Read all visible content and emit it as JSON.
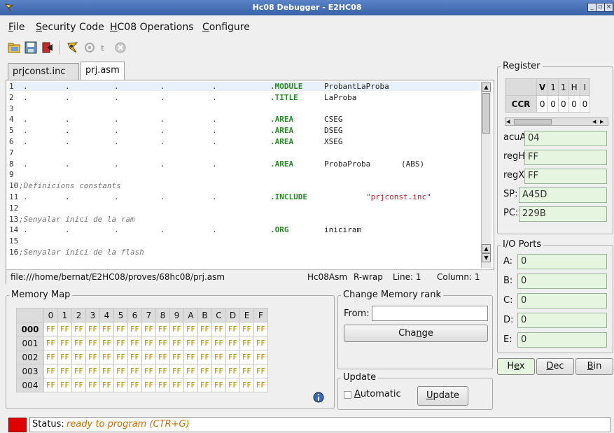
{
  "window": {
    "title": "Hc08 Debugger - E2HC08"
  },
  "menu": [
    {
      "label": "File",
      "mnemonic": "F"
    },
    {
      "label": "Security Code",
      "mnemonic": "S"
    },
    {
      "label": "HC08 Operations",
      "mnemonic": "H"
    },
    {
      "label": "Configure",
      "mnemonic": "C"
    }
  ],
  "toolbar": [
    "open-folder-icon",
    "save-icon",
    "exit-icon",
    "program-chip-icon",
    "run-icon",
    "step-icon",
    "stop-icon"
  ],
  "editor": {
    "tabs": [
      "prjconst.inc",
      "prj.asm"
    ],
    "active_tab": 1,
    "lines": [
      {
        "n": "1",
        "dots": true,
        "directive": ".MODULE",
        "arg": "ProbantLaProba"
      },
      {
        "n": "2",
        "dots": true,
        "directive": ".TITLE",
        "arg": "LaProba"
      },
      {
        "n": "3"
      },
      {
        "n": "4",
        "dots": true,
        "directive": ".AREA",
        "arg": "CSEG"
      },
      {
        "n": "5",
        "dots": true,
        "directive": ".AREA",
        "arg": "DSEG"
      },
      {
        "n": "6",
        "dots": true,
        "directive": ".AREA",
        "arg": "XSEG"
      },
      {
        "n": "7"
      },
      {
        "n": "8",
        "dots": true,
        "directive": ".AREA",
        "arg": "ProbaProba",
        "arg2": "(ABS)"
      },
      {
        "n": "9"
      },
      {
        "n": "10",
        "comment": ";Definicions constants"
      },
      {
        "n": "11",
        "dots": true,
        "directive": ".INCLUDE",
        "string": "\"prjconst.inc\""
      },
      {
        "n": "12"
      },
      {
        "n": "13",
        "comment": ";Senyalar inici de la ram"
      },
      {
        "n": "14",
        "dots": true,
        "directive": ".ORG",
        "arg": "iniciram"
      },
      {
        "n": "15"
      },
      {
        "n": "16",
        "comment": ";Senyalar inici de la flash"
      }
    ],
    "status": {
      "path": "file:///home/bernat/E2HC08/proves/68hc08/prj.asm",
      "mode": "Hc08Asm",
      "wrap": "R-wrap",
      "line": "Line: 1",
      "column": "Column: 1"
    }
  },
  "memory_map": {
    "title": "Memory Map",
    "columns": [
      "0",
      "1",
      "2",
      "3",
      "4",
      "5",
      "6",
      "7",
      "8",
      "9",
      "A",
      "B",
      "C",
      "D",
      "E",
      "F"
    ],
    "rows": [
      {
        "addr": "000",
        "bold": true,
        "values": [
          "FF",
          "FF",
          "FF",
          "FF",
          "FF",
          "FF",
          "FF",
          "FF",
          "FF",
          "FF",
          "FF",
          "FF",
          "FF",
          "FF",
          "FF",
          "FF"
        ]
      },
      {
        "addr": "001",
        "values": [
          "FF",
          "FF",
          "FF",
          "FF",
          "FF",
          "FF",
          "FF",
          "FF",
          "FF",
          "FF",
          "FF",
          "FF",
          "FF",
          "FF",
          "FF",
          "FF"
        ]
      },
      {
        "addr": "002",
        "values": [
          "FF",
          "FF",
          "FF",
          "FF",
          "FF",
          "FF",
          "FF",
          "FF",
          "FF",
          "FF",
          "FF",
          "FF",
          "FF",
          "FF",
          "FF",
          "FF"
        ]
      },
      {
        "addr": "003",
        "values": [
          "FF",
          "FF",
          "FF",
          "FF",
          "FF",
          "FF",
          "FF",
          "FF",
          "FF",
          "FF",
          "FF",
          "FF",
          "FF",
          "FF",
          "FF",
          "FF"
        ]
      },
      {
        "addr": "004",
        "values": [
          "FF",
          "FF",
          "FF",
          "FF",
          "FF",
          "FF",
          "FF",
          "FF",
          "FF",
          "FF",
          "FF",
          "FF",
          "FF",
          "FF",
          "FF",
          "FF"
        ]
      }
    ]
  },
  "change_rank": {
    "title": "Change Memory rank",
    "from_label": "From:",
    "from_value": "",
    "button": "Change",
    "button_mnemonic": "n"
  },
  "update": {
    "title": "Update",
    "automatic_label": "Automatic",
    "automatic_checked": false,
    "button": "Update",
    "button_mnemonic": "U"
  },
  "register": {
    "title": "Register",
    "ccr_header": [
      "V",
      "1",
      "1",
      "H",
      "I"
    ],
    "ccr_label": "CCR",
    "ccr_values": [
      "0",
      "0",
      "0",
      "0",
      "0"
    ],
    "fields": [
      {
        "label": "acuA:",
        "value": "04"
      },
      {
        "label": "regH:",
        "value": "FF"
      },
      {
        "label": "regX:",
        "value": "FF"
      },
      {
        "label": "SP:",
        "value": "A45D"
      },
      {
        "label": "PC:",
        "value": "229B"
      }
    ]
  },
  "io_ports": {
    "title": "I/O Ports",
    "ports": [
      {
        "label": "A:",
        "value": "0"
      },
      {
        "label": "B:",
        "value": "0"
      },
      {
        "label": "C:",
        "value": "0"
      },
      {
        "label": "D:",
        "value": "0"
      },
      {
        "label": "E:",
        "value": "0"
      }
    ]
  },
  "base_buttons": [
    {
      "label": "Hex",
      "mnemonic": "e"
    },
    {
      "label": "Dec",
      "mnemonic": "D"
    },
    {
      "label": "Bin",
      "mnemonic": "B"
    }
  ],
  "status": {
    "label": "Status:",
    "text": "ready to program (CTR+G)",
    "led_color": "#e00000"
  },
  "colors": {
    "directive": "#2a8a2a",
    "string": "#c0202a",
    "status_text": "#d06a00"
  }
}
